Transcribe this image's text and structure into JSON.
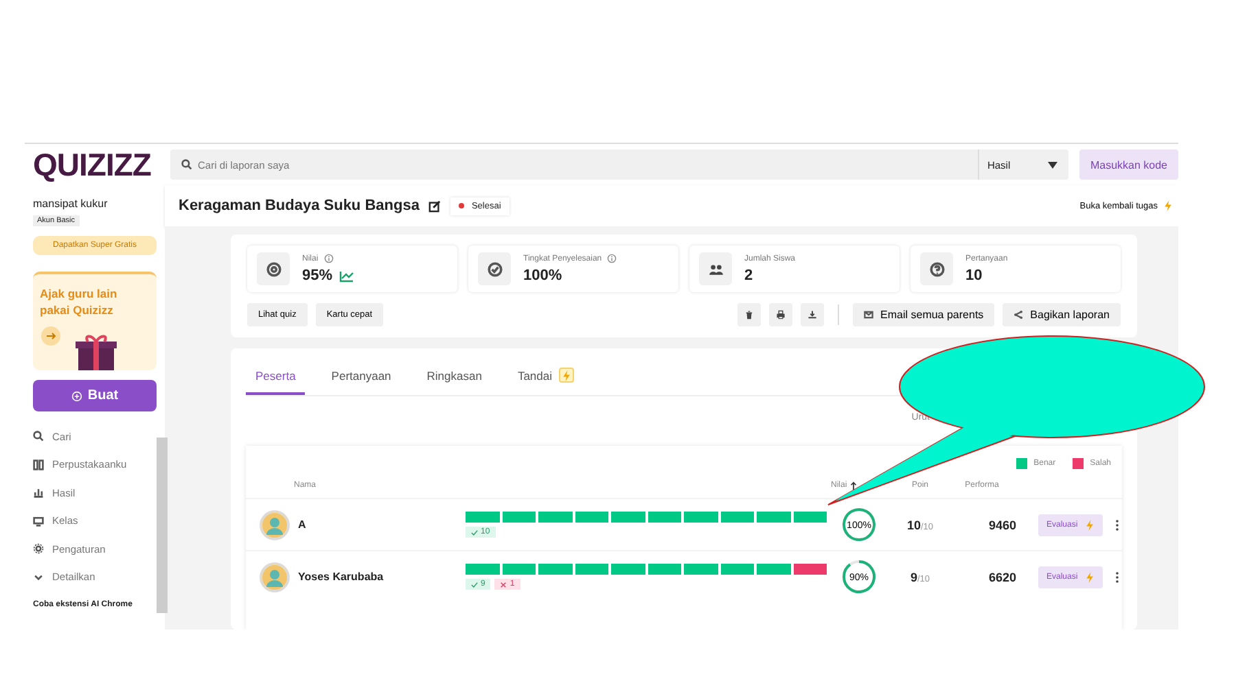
{
  "logo": "QUIZIZZ",
  "sidebar": {
    "user": "mansipat kukur",
    "plan": "Akun Basic",
    "upgrade": "Dapatkan Super Gratis",
    "promo": "Ajak guru lain pakai Quizizz",
    "create": "Buat",
    "items": [
      {
        "label": "Cari"
      },
      {
        "label": "Perpustakaanku"
      },
      {
        "label": "Hasil"
      },
      {
        "label": "Kelas"
      },
      {
        "label": "Pengaturan"
      },
      {
        "label": "Detailkan"
      }
    ],
    "footer": "Coba ekstensi AI Chrome"
  },
  "search": {
    "placeholder": "Cari di laporan saya",
    "filter": "Hasil"
  },
  "enter_code": "Masukkan kode",
  "title": "Keragaman Budaya Suku Bangsa",
  "status": "Selesai",
  "reopen": "Buka kembali tugas",
  "stats": [
    {
      "label": "Nilai",
      "value": "95%",
      "info": true,
      "trend": true
    },
    {
      "label": "Tingkat Penyelesaian",
      "value": "100%",
      "info": true,
      "trend": false
    },
    {
      "label": "Jumlah Siswa",
      "value": "2",
      "info": false,
      "trend": false
    },
    {
      "label": "Pertanyaan",
      "value": "10",
      "info": false,
      "trend": false
    }
  ],
  "actions": [
    "Lihat quiz",
    "Kartu cepat"
  ],
  "share_actions": [
    "Email semua parents",
    "Bagikan laporan"
  ],
  "tabs": [
    {
      "label": "Peserta",
      "selected": true,
      "badge": false
    },
    {
      "label": "Pertanyaan",
      "selected": false,
      "badge": false
    },
    {
      "label": "Ringkasan",
      "selected": false,
      "badge": false
    },
    {
      "label": "Tandai",
      "selected": false,
      "badge": true
    }
  ],
  "sort_label": "Urut",
  "legend": [
    {
      "label": "Benar",
      "color": "#00c985"
    },
    {
      "label": "Salah",
      "color": "#ec3b6b"
    }
  ],
  "table": {
    "columns": [
      "Nama",
      "Nilai",
      "Poin",
      "Performa"
    ],
    "rows": [
      {
        "name": "A",
        "answers": [
          true,
          true,
          true,
          true,
          true,
          true,
          true,
          true,
          true,
          true
        ],
        "correct": "10",
        "wrong": "",
        "score": "100%",
        "level": 1.0,
        "points": "10",
        "total": "/10",
        "performance": "9460",
        "action": "Evaluasi"
      },
      {
        "name": "Yoses Karubaba",
        "answers": [
          true,
          true,
          true,
          true,
          true,
          true,
          true,
          true,
          true,
          false
        ],
        "correct": "9",
        "wrong": "1",
        "score": "90%",
        "level": 0.9,
        "points": "9",
        "total": "/10",
        "performance": "6620",
        "action": "Evaluasi"
      }
    ]
  }
}
